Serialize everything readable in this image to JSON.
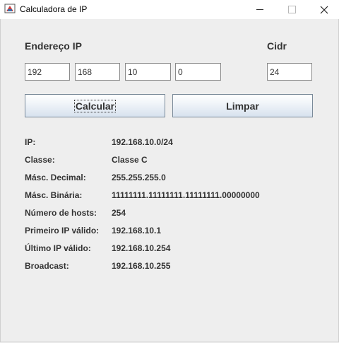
{
  "window": {
    "title": "Calculadora de IP",
    "controls": [
      "minimize-icon",
      "maximize-icon",
      "close-icon"
    ]
  },
  "form": {
    "endereco_label": "Endereço IP",
    "cidr_label": "Cidr",
    "octets": [
      "192",
      "168",
      "10",
      "0"
    ],
    "cidr_value": "24"
  },
  "buttons": {
    "calcular": "Calcular",
    "limpar": "Limpar"
  },
  "results": [
    {
      "label": "IP:",
      "value": "192.168.10.0/24"
    },
    {
      "label": "Classe:",
      "value": "Classe C"
    },
    {
      "label": "Másc. Decimal:",
      "value": "255.255.255.0"
    },
    {
      "label": "Másc. Binária:",
      "value": "11111111.11111111.11111111.00000000"
    },
    {
      "label": "Número de hosts:",
      "value": "254"
    },
    {
      "label": "Primeiro IP válido:",
      "value": "192.168.10.1"
    },
    {
      "label": "Último IP válido:",
      "value": "192.168.10.254"
    },
    {
      "label": "Broadcast:",
      "value": "192.168.10.255"
    }
  ]
}
